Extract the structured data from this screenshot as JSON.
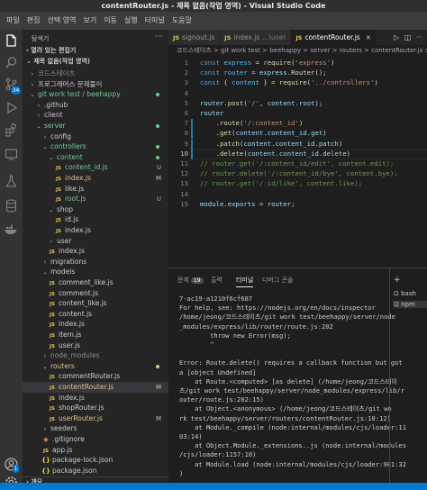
{
  "window": {
    "title": "contentRouter.js - 제목 없음(작업 영역) - Visual Studio Code"
  },
  "menu": [
    "파일",
    "편집",
    "선택 영역",
    "보기",
    "이동",
    "실행",
    "터미널",
    "도움말"
  ],
  "activity": {
    "scm_badge": "34",
    "icons": [
      "files-icon",
      "search-icon",
      "source-control-icon",
      "run-debug-icon",
      "extensions-icon",
      "remote-explorer-icon",
      "testing-icon",
      "database-icon",
      "docker-icon",
      "accounts-icon",
      "manage-icon"
    ]
  },
  "sidebar": {
    "title": "탐색기",
    "more": "···",
    "open_editors": "열려 있는 편집기",
    "workspace": "제목 없음(작업 영역)",
    "outline": "개요",
    "tree": [
      {
        "label": "코드스테이츠",
        "depth": 1,
        "type": "folder",
        "open": false,
        "color": "gray"
      },
      {
        "label": "프로그래머스 문제풀이",
        "depth": 1,
        "type": "folder",
        "open": false,
        "color": "default"
      },
      {
        "label": "git work test / beehappy",
        "depth": 1,
        "type": "folder",
        "open": true,
        "color": "green",
        "dot": true
      },
      {
        "label": ".github",
        "depth": 2,
        "type": "folder",
        "open": false,
        "color": "default"
      },
      {
        "label": "client",
        "depth": 2,
        "type": "folder",
        "open": false,
        "color": "default"
      },
      {
        "label": "server",
        "depth": 2,
        "type": "folder",
        "open": true,
        "color": "green",
        "dot": true
      },
      {
        "label": "config",
        "depth": 3,
        "type": "folder",
        "open": false,
        "color": "default"
      },
      {
        "label": "controllers",
        "depth": 3,
        "type": "folder",
        "open": true,
        "color": "green",
        "dot": true
      },
      {
        "label": "content",
        "depth": 4,
        "type": "folder",
        "open": true,
        "color": "green",
        "dot": true
      },
      {
        "label": "content_id.js",
        "depth": 5,
        "type": "js",
        "color": "green",
        "badge": "U"
      },
      {
        "label": "index.js",
        "depth": 5,
        "type": "js",
        "color": "orange",
        "badge": "M"
      },
      {
        "label": "like.js",
        "depth": 5,
        "type": "js",
        "color": "default"
      },
      {
        "label": "root.js",
        "depth": 5,
        "type": "js",
        "color": "green",
        "badge": "U"
      },
      {
        "label": "shop",
        "depth": 4,
        "type": "folder",
        "open": true,
        "color": "default"
      },
      {
        "label": "id.js",
        "depth": 5,
        "type": "js",
        "color": "default"
      },
      {
        "label": "index.js",
        "depth": 5,
        "type": "js",
        "color": "default"
      },
      {
        "label": "user",
        "depth": 4,
        "type": "folder",
        "open": false,
        "color": "default"
      },
      {
        "label": "index.js",
        "depth": 4,
        "type": "js",
        "color": "default"
      },
      {
        "label": "migrations",
        "depth": 3,
        "type": "folder",
        "open": false,
        "color": "default"
      },
      {
        "label": "models",
        "depth": 3,
        "type": "folder",
        "open": true,
        "color": "default"
      },
      {
        "label": "comment_like.js",
        "depth": 4,
        "type": "js",
        "color": "default"
      },
      {
        "label": "comment.js",
        "depth": 4,
        "type": "js",
        "color": "default"
      },
      {
        "label": "content_like.js",
        "depth": 4,
        "type": "js",
        "color": "default"
      },
      {
        "label": "content.js",
        "depth": 4,
        "type": "js",
        "color": "default"
      },
      {
        "label": "index.js",
        "depth": 4,
        "type": "js",
        "color": "default"
      },
      {
        "label": "item.js",
        "depth": 4,
        "type": "js",
        "color": "default"
      },
      {
        "label": "user.js",
        "depth": 4,
        "type": "js",
        "color": "default"
      },
      {
        "label": "node_modules",
        "depth": 3,
        "type": "folder",
        "open": false,
        "color": "gray"
      },
      {
        "label": "routers",
        "depth": 3,
        "type": "folder",
        "open": true,
        "color": "orange",
        "dot": true
      },
      {
        "label": "commentRouter.js",
        "depth": 4,
        "type": "js",
        "color": "default"
      },
      {
        "label": "contentRouter.js",
        "depth": 4,
        "type": "js",
        "color": "orange",
        "badge": "M",
        "selected": true
      },
      {
        "label": "index.js",
        "depth": 4,
        "type": "js",
        "color": "default"
      },
      {
        "label": "shopRouter.js",
        "depth": 4,
        "type": "js",
        "color": "default"
      },
      {
        "label": "userRouter.js",
        "depth": 4,
        "type": "js",
        "color": "orange",
        "badge": "M"
      },
      {
        "label": "seeders",
        "depth": 3,
        "type": "folder",
        "open": false,
        "color": "default"
      },
      {
        "label": ".gitignore",
        "depth": 3,
        "type": "git",
        "color": "default"
      },
      {
        "label": "app.js",
        "depth": 3,
        "type": "js",
        "color": "default"
      },
      {
        "label": "package-lock.json",
        "depth": 3,
        "type": "json",
        "color": "default"
      },
      {
        "label": "package.json",
        "depth": 3,
        "type": "json",
        "color": "default"
      }
    ]
  },
  "tabs": [
    {
      "label": "signout.js",
      "active": false
    },
    {
      "label": "index.js",
      "suffix": "...\\user",
      "active": false
    },
    {
      "label": "contentRouter.js",
      "active": true
    }
  ],
  "breadcrumb": "코드스테이츠 > git work test > beehappy > server > routers > contentRouter.js > ...",
  "code": {
    "lines": [
      [
        [
          "k",
          "const "
        ],
        [
          "c4",
          "express"
        ],
        [
          "p",
          " = "
        ],
        [
          "f",
          "require"
        ],
        [
          "p",
          "("
        ],
        [
          "s",
          "'express'"
        ],
        [
          "p",
          ")"
        ]
      ],
      [
        [
          "k",
          "const "
        ],
        [
          "c4",
          "router"
        ],
        [
          "p",
          " = "
        ],
        [
          "v",
          "express"
        ],
        [
          "p",
          "."
        ],
        [
          "f",
          "Router"
        ],
        [
          "p",
          "();"
        ]
      ],
      [
        [
          "k",
          "const "
        ],
        [
          "p",
          "{ "
        ],
        [
          "c4",
          "content"
        ],
        [
          "p",
          " } = "
        ],
        [
          "f",
          "require"
        ],
        [
          "p",
          "("
        ],
        [
          "s",
          "'../controllers'"
        ],
        [
          "p",
          ")"
        ]
      ],
      [],
      [
        [
          "v",
          "router"
        ],
        [
          "p",
          "."
        ],
        [
          "f",
          "post"
        ],
        [
          "p",
          "("
        ],
        [
          "s",
          "'/'"
        ],
        [
          "p",
          ", "
        ],
        [
          "v",
          "content"
        ],
        [
          "p",
          "."
        ],
        [
          "v",
          "root"
        ],
        [
          "p",
          ");"
        ]
      ],
      [
        [
          "v",
          "router"
        ]
      ],
      [
        [
          "p",
          "    ."
        ],
        [
          "f",
          "route"
        ],
        [
          "p",
          "("
        ],
        [
          "s",
          "'/:content_id'"
        ],
        [
          "p",
          ")"
        ]
      ],
      [
        [
          "p",
          "    ."
        ],
        [
          "f",
          "get"
        ],
        [
          "p",
          "("
        ],
        [
          "v",
          "content"
        ],
        [
          "p",
          "."
        ],
        [
          "v",
          "content_id"
        ],
        [
          "p",
          "."
        ],
        [
          "v",
          "get"
        ],
        [
          "p",
          ")"
        ]
      ],
      [
        [
          "p",
          "    ."
        ],
        [
          "f",
          "patch"
        ],
        [
          "p",
          "("
        ],
        [
          "v",
          "content"
        ],
        [
          "p",
          "."
        ],
        [
          "v",
          "content_id"
        ],
        [
          "p",
          "."
        ],
        [
          "v",
          "patch"
        ],
        [
          "p",
          ")"
        ]
      ],
      [
        [
          "p",
          "    ."
        ],
        [
          "f",
          "delete"
        ],
        [
          "p",
          "("
        ],
        [
          "v",
          "content"
        ],
        [
          "p",
          "."
        ],
        [
          "v",
          "content_id"
        ],
        [
          "p",
          "."
        ],
        [
          "v",
          "delete"
        ],
        [
          "p",
          ")"
        ]
      ],
      [
        [
          "cm",
          "// router.get('/:content_id/edit', content.edit);"
        ]
      ],
      [
        [
          "cm",
          "// router.delete('/:content_id/bye', content.bye);"
        ]
      ],
      [
        [
          "cm",
          "// router.get('/:id/like', content.like);"
        ]
      ],
      [],
      [
        [
          "v",
          "module"
        ],
        [
          "p",
          "."
        ],
        [
          "v",
          "exports"
        ],
        [
          "p",
          " = "
        ],
        [
          "v",
          "router"
        ],
        [
          "p",
          ";"
        ]
      ]
    ],
    "active_line": 10
  },
  "panel": {
    "tabs": [
      {
        "label": "문제",
        "badge": "19"
      },
      {
        "label": "출력"
      },
      {
        "label": "터미널",
        "active": true
      },
      {
        "label": "디버그 콘솔"
      }
    ],
    "terminal_lines": [
      "7-ac19-a1210f6cf687",
      "For help, see: https://nodejs.org/en/docs/inspector",
      "/home/jeong/코드스테이츠/git work test/beehappy/server/node",
      "_modules/express/lib/router/route.js:202",
      "        throw new Error(msg);",
      "        ^",
      "",
      "Error: Route.delete() requires a callback function but got",
      "a [object Undefined]",
      "    at Route.<computed> [as delete] (/home/jeong/코드스테이",
      "츠/git work test/beehappy/server/node_modules/express/lib/r",
      "outer/route.js:202:15)",
      "    at Object.<anonymous> (/home/jeong/코드스테이츠/git wo",
      "rk test/beehappy/server/routers/contentRouter.js:10:12)",
      "    at Module._compile (node:internal/modules/cjs/loader:11",
      "03:14)",
      "    at Object.Module._extensions..js (node:internal/modules",
      "/cjs/loader:1157:10)",
      "    at Module.load (node:internal/modules/cjs/loader:981:32",
      ")"
    ],
    "terminals": [
      "bash",
      "npm"
    ],
    "add_label": "+"
  }
}
